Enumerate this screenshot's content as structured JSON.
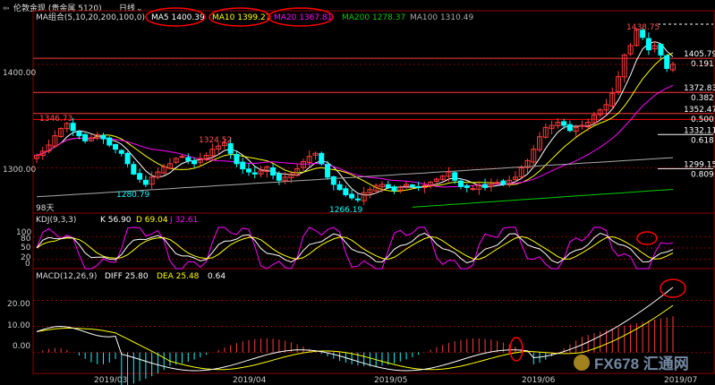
{
  "header": {
    "title": "伦敦金现 (贵金属 5120)",
    "period": "日线",
    "back_icon": "back-arrow-icon",
    "dropdown_icon": "chevron-down-icon"
  },
  "ma_legend": {
    "label": "MA组合(5,10,20,200,100,0)",
    "items": [
      {
        "text": "MA5 1400.39",
        "color": "#ffffff"
      },
      {
        "text": "MA10 1399.27",
        "color": "#ffff00"
      },
      {
        "text": "MA20 1367.81",
        "color": "#ff00ff"
      },
      {
        "text": "MA200 1278.37",
        "color": "#00cc00"
      },
      {
        "text": "MA100 1310.49",
        "color": "#aaaaaa"
      }
    ]
  },
  "kdj_legend": {
    "label": "KDJ(9,3,3)",
    "items": [
      {
        "text": "K 56.90",
        "color": "#ffffff"
      },
      {
        "text": "D 69.04",
        "color": "#ffff00"
      },
      {
        "text": "J 32.61",
        "color": "#ff00ff"
      }
    ]
  },
  "macd_legend": {
    "label": "MACD(12,26,9)",
    "items": [
      {
        "text": "DIFF 25.80",
        "color": "#ffffff"
      },
      {
        "text": "DEA 25.48",
        "color": "#ffff00"
      },
      {
        "text": "0.64",
        "color": "#ffffff"
      }
    ]
  },
  "price_axis_labels": [
    "1400.00",
    "1300.00"
  ],
  "kdj_axis_labels": [
    "100",
    "80",
    "50",
    "20",
    "0"
  ],
  "macd_axis_labels": [
    "20.00",
    "10.00",
    "0.00"
  ],
  "date_labels": [
    "2019/03",
    "2019/04",
    "2019/05",
    "2019/06",
    "2019/07"
  ],
  "price_annotations": {
    "high_1438": "1438.75",
    "high_1346": "1346.73",
    "high_1324": "1324.52",
    "low_1280": "1280.79",
    "low_1266": "1266.19",
    "days": "98天"
  },
  "fib_levels": [
    {
      "price": "1405.79",
      "ratio": "0.191"
    },
    {
      "price": "1372.83",
      "ratio": "0.382"
    },
    {
      "price": "1352.47",
      "ratio": "0.500"
    },
    {
      "price": "1332.11",
      "ratio": "0.618"
    },
    {
      "price": "1299.15",
      "ratio": "0.809"
    }
  ],
  "watermark": "FX678 汇通网",
  "colors": {
    "up": "#ff3b3b",
    "down": "#00ffff",
    "ma5": "#ffffff",
    "ma10": "#ffff00",
    "ma20": "#ff00ff",
    "ma100": "#aaaaaa",
    "ma200": "#00cc00",
    "axis": "#8b0000",
    "highlight": "#ff0000"
  },
  "chart_data": [
    {
      "type": "candlestick",
      "title": "伦敦金现 日线",
      "ylim": [
        1258,
        1450
      ],
      "x_range": [
        "2019/02",
        "2019/07"
      ],
      "annotated_points": [
        {
          "label": "1438.75",
          "kind": "high",
          "date": "2019/07"
        },
        {
          "label": "1346.73",
          "kind": "high",
          "date": "2019/02"
        },
        {
          "label": "1324.52",
          "kind": "high",
          "date": "2019/03"
        },
        {
          "label": "1280.79",
          "kind": "low",
          "date": "2019/03"
        },
        {
          "label": "1266.19",
          "kind": "low",
          "date": "2019/04"
        }
      ],
      "closes": [
        1312,
        1316,
        1322,
        1331,
        1338,
        1343,
        1336,
        1331,
        1326,
        1329,
        1332,
        1328,
        1322,
        1318,
        1314,
        1304,
        1294,
        1289,
        1284,
        1291,
        1296,
        1301,
        1304,
        1309,
        1311,
        1307,
        1304,
        1309,
        1312,
        1318,
        1321,
        1324,
        1314,
        1304,
        1299,
        1296,
        1294,
        1297,
        1301,
        1293,
        1288,
        1291,
        1294,
        1299,
        1306,
        1311,
        1314,
        1304,
        1291,
        1284,
        1279,
        1274,
        1271,
        1269,
        1276,
        1279,
        1283,
        1284,
        1281,
        1278,
        1281,
        1284,
        1282,
        1281,
        1283,
        1286,
        1289,
        1292,
        1296,
        1288,
        1282,
        1281,
        1280,
        1283,
        1281,
        1284,
        1286,
        1284,
        1288,
        1291,
        1300,
        1307,
        1318,
        1330,
        1339,
        1341,
        1344,
        1341,
        1336,
        1339,
        1341,
        1344,
        1351,
        1356,
        1361,
        1372,
        1388,
        1409,
        1418,
        1433,
        1426,
        1414,
        1418,
        1409,
        1396,
        1400
      ],
      "series": [
        {
          "name": "MA5",
          "last": 1400.39
        },
        {
          "name": "MA10",
          "last": 1399.27
        },
        {
          "name": "MA20",
          "last": 1367.81
        },
        {
          "name": "MA200",
          "last": 1278.37
        },
        {
          "name": "MA100",
          "last": 1310.49
        }
      ],
      "fib_levels": [
        {
          "ratio": 0.191,
          "price": 1405.79
        },
        {
          "ratio": 0.382,
          "price": 1372.83
        },
        {
          "ratio": 0.5,
          "price": 1352.47
        },
        {
          "ratio": 0.618,
          "price": 1332.11
        },
        {
          "ratio": 0.809,
          "price": 1299.15
        }
      ]
    },
    {
      "type": "line",
      "title": "KDJ(9,3,3)",
      "ylim": [
        0,
        100
      ],
      "series": [
        {
          "name": "K",
          "last": 56.9
        },
        {
          "name": "D",
          "last": 69.04
        },
        {
          "name": "J",
          "last": 32.61
        }
      ]
    },
    {
      "type": "bar",
      "title": "MACD(12,26,9)",
      "ylim": [
        -7,
        26
      ],
      "series": [
        {
          "name": "DIFF",
          "last": 25.8
        },
        {
          "name": "DEA",
          "last": 25.48
        },
        {
          "name": "MACD",
          "last": 0.64
        }
      ]
    }
  ]
}
